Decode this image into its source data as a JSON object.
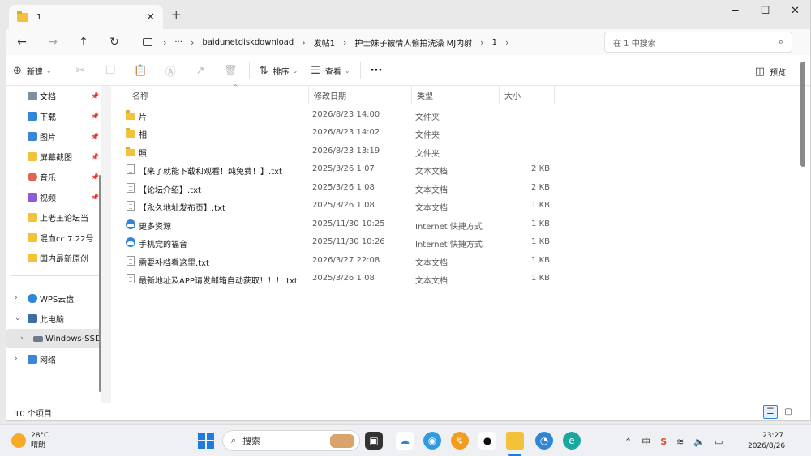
{
  "window": {
    "tab_title": "1",
    "new_tab_label": "+",
    "controls": {
      "minimize": "─",
      "maximize": "☐",
      "close": "✕"
    }
  },
  "address": {
    "crumbs": [
      "baidunetdiskdownload",
      "发帖1",
      "护士妹子被情人偷拍洗澡 MJ内射",
      "1"
    ],
    "more": "···",
    "search_placeholder": "在 1 中搜索"
  },
  "toolbar": {
    "new_label": "新建",
    "sort_label": "排序",
    "view_label": "查看",
    "more_label": "···",
    "preview_label": "预览"
  },
  "nav": {
    "quick": [
      {
        "label": "文档",
        "icon": "document-icon",
        "color": "#7f8ea3"
      },
      {
        "label": "下载",
        "icon": "download-icon",
        "color": "#2f86d6"
      },
      {
        "label": "图片",
        "icon": "pictures-icon",
        "color": "#3b86d8"
      },
      {
        "label": "屏幕截图",
        "icon": "folder-icon",
        "color": "#f2c23a"
      },
      {
        "label": "音乐",
        "icon": "music-icon",
        "color": "#e0654e"
      },
      {
        "label": "视频",
        "icon": "video-icon",
        "color": "#8d5bd6"
      },
      {
        "label": "上老王论坛当",
        "icon": "folder-icon",
        "color": "#f2c23a"
      },
      {
        "label": "混血cc 7.22号",
        "icon": "folder-icon",
        "color": "#f2c23a"
      },
      {
        "label": "国内最新原创",
        "icon": "folder-icon",
        "color": "#f2c23a"
      }
    ],
    "tree": [
      {
        "label": "WPS云盘",
        "icon": "cloud-icon",
        "chevron": "›"
      },
      {
        "label": "此电脑",
        "icon": "computer-icon",
        "chevron": "⌄"
      },
      {
        "label": "Windows-SSD",
        "icon": "drive-icon",
        "chevron": "›"
      },
      {
        "label": "网络",
        "icon": "network-icon",
        "chevron": "›"
      }
    ]
  },
  "columns": {
    "name": "名称",
    "date": "修改日期",
    "type": "类型",
    "size": "大小"
  },
  "files": [
    {
      "name": "片",
      "date": "2026/8/23 14:00",
      "type": "文件夹",
      "size": "",
      "kind": "folder"
    },
    {
      "name": "相",
      "date": "2026/8/23 14:02",
      "type": "文件夹",
      "size": "",
      "kind": "folder"
    },
    {
      "name": "照",
      "date": "2026/8/23 13:19",
      "type": "文件夹",
      "size": "",
      "kind": "folder"
    },
    {
      "name": "【来了就能下载和观看！纯免费！】.txt",
      "date": "2025/3/26 1:07",
      "type": "文本文档",
      "size": "2 KB",
      "kind": "txt"
    },
    {
      "name": "【论坛介绍】.txt",
      "date": "2025/3/26 1:08",
      "type": "文本文档",
      "size": "2 KB",
      "kind": "txt"
    },
    {
      "name": "【永久地址发布页】.txt",
      "date": "2025/3/26 1:08",
      "type": "文本文档",
      "size": "1 KB",
      "kind": "txt"
    },
    {
      "name": "更多资源",
      "date": "2025/11/30 10:25",
      "type": "Internet 快捷方式",
      "size": "1 KB",
      "kind": "url"
    },
    {
      "name": "手机党的福音",
      "date": "2025/11/30 10:26",
      "type": "Internet 快捷方式",
      "size": "1 KB",
      "kind": "url"
    },
    {
      "name": "需要补档看这里.txt",
      "date": "2026/3/27 22:08",
      "type": "文本文档",
      "size": "1 KB",
      "kind": "txt"
    },
    {
      "name": "最新地址及APP请发邮箱自动获取！！！.txt",
      "date": "2025/3/26 1:08",
      "type": "文本文档",
      "size": "1 KB",
      "kind": "txt"
    }
  ],
  "status": {
    "count": "10 个项目"
  },
  "taskbar": {
    "weather_temp": "28°C",
    "weather_desc": "晴朗",
    "search_label": "搜索",
    "tray_ime": "中",
    "time": "23:27",
    "date": "2026/8/26"
  },
  "colors": {
    "accent": "#1f7be0",
    "folder": "#f2c23a"
  }
}
